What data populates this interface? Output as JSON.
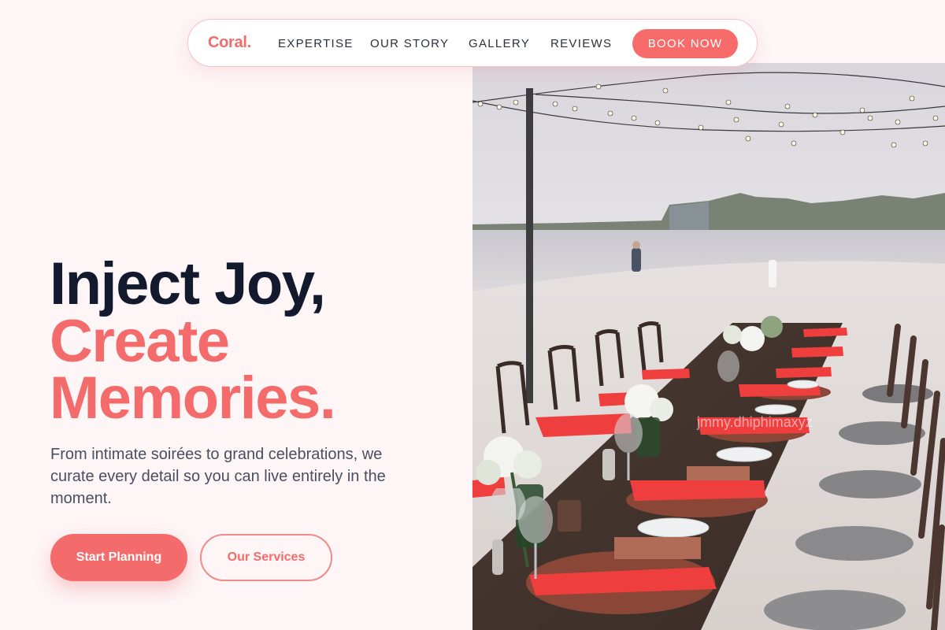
{
  "nav": {
    "brand": "Coral.",
    "links": [
      "EXPERTISE",
      "OUR STORY",
      "GALLERY",
      "REVIEWS"
    ],
    "cta": "BOOK NOW"
  },
  "hero": {
    "line1": "Inject Joy,",
    "line2": "Create",
    "line3": "Memories.",
    "subtitle": "From intimate soirées to grand celebrations, we curate every detail so you can live entirely in the moment.",
    "primary_cta": "Start Planning",
    "secondary_cta": "Our Services",
    "image_watermark": "jmmy.dhiphimaxyz"
  },
  "colors": {
    "accent": "#f46b6b",
    "heading": "#141a2e",
    "background": "#fdf5f6"
  }
}
